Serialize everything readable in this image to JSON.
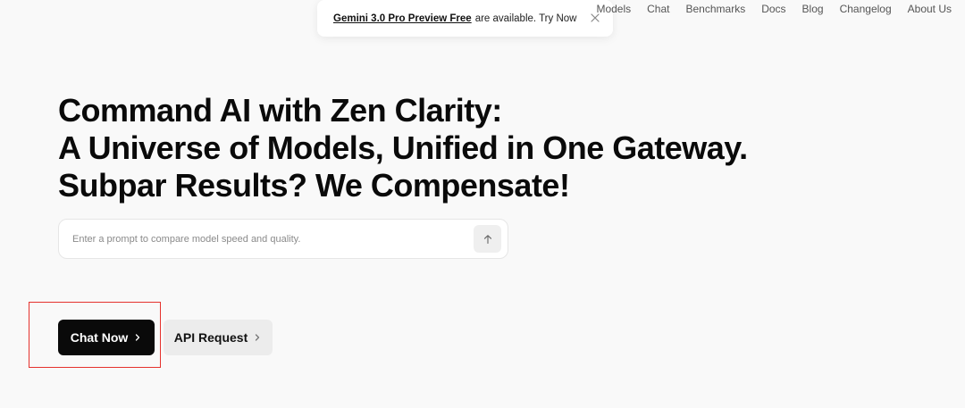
{
  "toast": {
    "link_text": "Gemini 3.0 Pro Preview Free",
    "message": "are available. Try Now",
    "close_icon": "close-icon"
  },
  "nav": {
    "items": [
      {
        "label": "Models"
      },
      {
        "label": "Chat"
      },
      {
        "label": "Benchmarks"
      },
      {
        "label": "Docs"
      },
      {
        "label": "Blog"
      },
      {
        "label": "Changelog"
      },
      {
        "label": "About Us"
      }
    ]
  },
  "hero": {
    "line1": "Command AI with Zen Clarity:",
    "line2": "A Universe of Models, Unified in One Gateway.",
    "line3": "Subpar Results? We Compensate!"
  },
  "prompt": {
    "placeholder": "Enter a prompt to compare model speed and quality.",
    "value": "",
    "send_icon": "arrow-up-icon"
  },
  "cta": {
    "primary_label": "Chat Now",
    "secondary_label": "API Request",
    "chevron_icon": "chevron-right-icon"
  },
  "colors": {
    "background": "#f9f9f9",
    "primary_button": "#0a0a0a",
    "secondary_button": "#ececec",
    "highlight": "#e5322d"
  }
}
